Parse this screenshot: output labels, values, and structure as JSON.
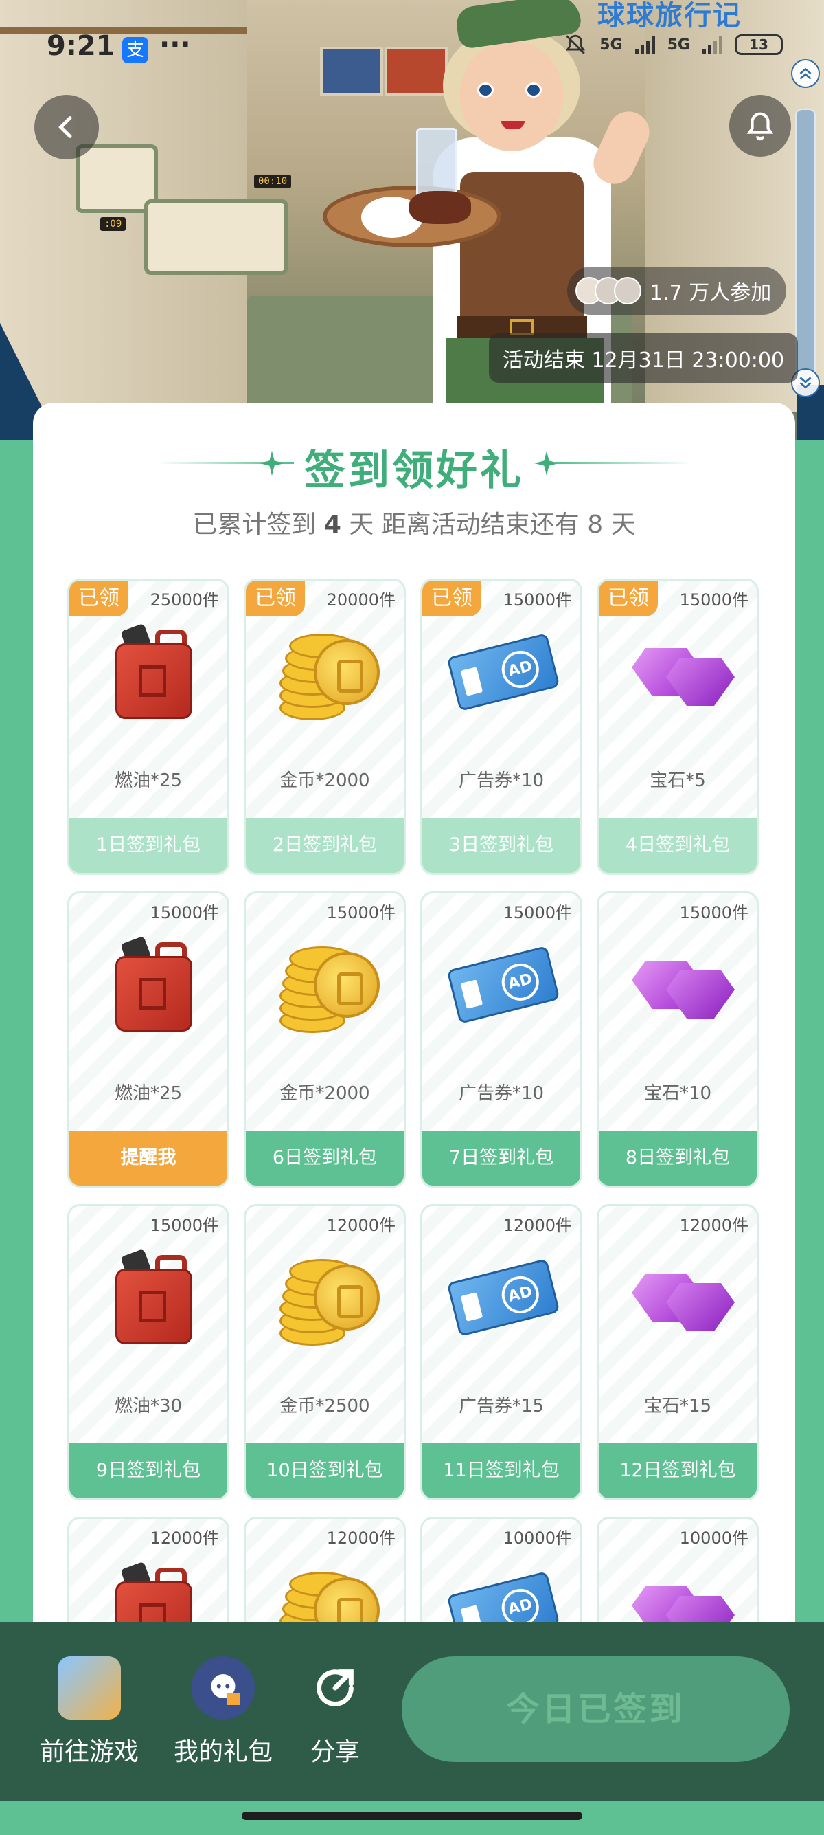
{
  "status_bar": {
    "time": "9:21",
    "app_badge": "支",
    "more": "···",
    "signal_1": "5G",
    "signal_2": "5G",
    "battery": "13"
  },
  "hero": {
    "sign_text": "球球旅行记",
    "oven_timer_1": "00:10",
    "oven_timer_2": ":09",
    "participants": "1.7 万人参加",
    "end_time": "活动结束 12月31日 23:00:00"
  },
  "card": {
    "title": "签到领好礼",
    "progress_prefix": "已累计签到",
    "signed_days": "4",
    "progress_mid": "天  距离活动结束还有",
    "remaining_days": "8",
    "progress_suffix": "天"
  },
  "rewards": [
    {
      "claimed": "已领",
      "stock": "25000件",
      "item": "fuel",
      "name": "燃油*25",
      "action": "1日签到礼包",
      "state": "claimed"
    },
    {
      "claimed": "已领",
      "stock": "20000件",
      "item": "coin",
      "name": "金币*2000",
      "action": "2日签到礼包",
      "state": "claimed"
    },
    {
      "claimed": "已领",
      "stock": "15000件",
      "item": "ad",
      "name": "广告券*10",
      "action": "3日签到礼包",
      "state": "claimed"
    },
    {
      "claimed": "已领",
      "stock": "15000件",
      "item": "gem",
      "name": "宝石*5",
      "action": "4日签到礼包",
      "state": "claimed"
    },
    {
      "claimed": "",
      "stock": "15000件",
      "item": "fuel",
      "name": "燃油*25",
      "action": "提醒我",
      "state": "remind"
    },
    {
      "claimed": "",
      "stock": "15000件",
      "item": "coin",
      "name": "金币*2000",
      "action": "6日签到礼包",
      "state": "future"
    },
    {
      "claimed": "",
      "stock": "15000件",
      "item": "ad",
      "name": "广告券*10",
      "action": "7日签到礼包",
      "state": "future"
    },
    {
      "claimed": "",
      "stock": "15000件",
      "item": "gem",
      "name": "宝石*10",
      "action": "8日签到礼包",
      "state": "future"
    },
    {
      "claimed": "",
      "stock": "15000件",
      "item": "fuel",
      "name": "燃油*30",
      "action": "9日签到礼包",
      "state": "future"
    },
    {
      "claimed": "",
      "stock": "12000件",
      "item": "coin",
      "name": "金币*2500",
      "action": "10日签到礼包",
      "state": "future"
    },
    {
      "claimed": "",
      "stock": "12000件",
      "item": "ad",
      "name": "广告券*15",
      "action": "11日签到礼包",
      "state": "future"
    },
    {
      "claimed": "",
      "stock": "12000件",
      "item": "gem",
      "name": "宝石*15",
      "action": "12日签到礼包",
      "state": "future"
    },
    {
      "claimed": "",
      "stock": "12000件",
      "item": "fuel",
      "name": "",
      "action": "",
      "state": "future"
    },
    {
      "claimed": "",
      "stock": "12000件",
      "item": "coin",
      "name": "",
      "action": "",
      "state": "future"
    },
    {
      "claimed": "",
      "stock": "10000件",
      "item": "ad",
      "name": "",
      "action": "",
      "state": "future"
    },
    {
      "claimed": "",
      "stock": "10000件",
      "item": "gem",
      "name": "",
      "action": "",
      "state": "future"
    }
  ],
  "bottom_bar": {
    "go_game": "前往游戏",
    "my_gifts": "我的礼包",
    "share": "分享",
    "signed_today": "今日已签到"
  },
  "colors": {
    "primary_green": "#5ec193",
    "title_green": "#3fae7a",
    "claimed_orange": "#f3a73d",
    "bottom_bar": "#2f5c49"
  }
}
